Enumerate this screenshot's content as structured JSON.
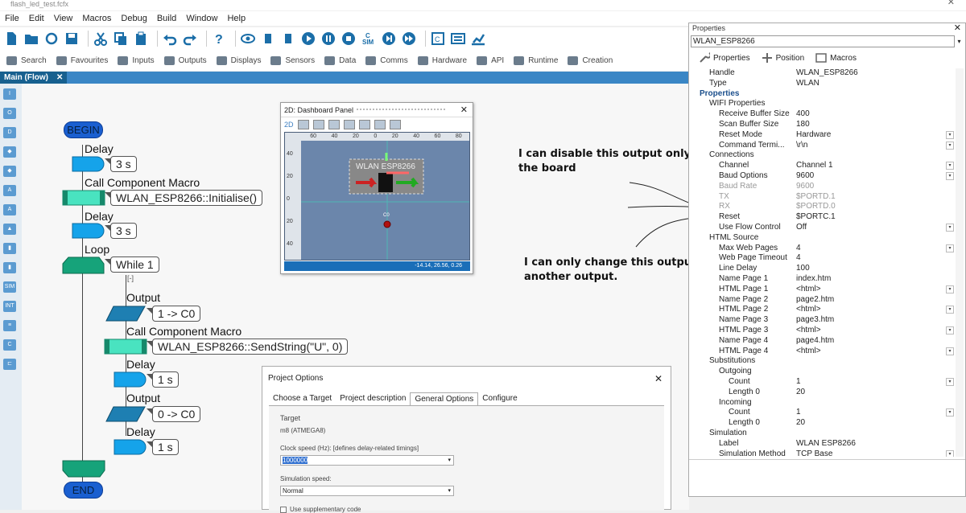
{
  "window": {
    "title": "flash_led_test.fcfx",
    "close": "✕"
  },
  "menu": [
    "File",
    "Edit",
    "View",
    "Macros",
    "Debug",
    "Build",
    "Window",
    "Help"
  ],
  "toolbar2": [
    "Search",
    "Favourites",
    "Inputs",
    "Outputs",
    "Displays",
    "Sensors",
    "Data",
    "Comms",
    "Hardware",
    "API",
    "Runtime",
    "Creation"
  ],
  "tab": {
    "label": "Main (Flow)",
    "close": "✕"
  },
  "leftbar": [
    "I",
    "O",
    "D",
    "◆",
    "◆",
    "A",
    "A",
    "▲",
    "▮",
    "▮",
    "SIM",
    "INT",
    "≡",
    "C",
    "⊏"
  ],
  "flow": {
    "begin": "BEGIN",
    "end": "END",
    "delay_label": "Delay",
    "delay1": "3 s",
    "macro_label": "Call Component Macro",
    "macro1": "WLAN_ESP8266::Initialise()",
    "delay2": "3 s",
    "loop_label": "Loop",
    "loop_cond": "While 1",
    "loop_marker": "[-]",
    "output_label": "Output",
    "out1": "1 -> C0",
    "macro2": "WLAN_ESP8266::SendString(\"U\", 0)",
    "delay3": "1 s",
    "out2": "0 -> C0",
    "delay4": "1 s"
  },
  "dashboard": {
    "title": "2D: Dashboard Panel",
    "close": "✕",
    "tool_label": "2D",
    "component_label": "WLAN ESP8266",
    "status": "-14.14, 26.56, 0.26",
    "ruler_top": [
      "60",
      "40",
      "20",
      "0",
      "20",
      "40",
      "60",
      "80"
    ],
    "ruler_left": [
      "40",
      "20",
      "0",
      "20",
      "40"
    ],
    "point_label": "C0"
  },
  "annotations": {
    "a1_line1": "I can disable this output only on",
    "a1_line2": "the board",
    "a2_line1": "I can only change this output to",
    "a2_line2": "another output."
  },
  "properties": {
    "title": "Properties",
    "close": "✕",
    "selected": "WLAN_ESP8266",
    "tabs": [
      "Properties",
      "Position",
      "Macros"
    ],
    "rows": [
      {
        "name": "Handle",
        "value": "WLAN_ESP8266",
        "indent": 1
      },
      {
        "name": "Type",
        "value": "WLAN",
        "indent": 1
      },
      {
        "name": "Properties",
        "value": "",
        "indent": 0,
        "head": true
      },
      {
        "name": "WIFI Properties",
        "value": "",
        "indent": 1
      },
      {
        "name": "Receive Buffer Size",
        "value": "400",
        "indent": 2
      },
      {
        "name": "Scan Buffer Size",
        "value": "180",
        "indent": 2
      },
      {
        "name": "Reset Mode",
        "value": "Hardware",
        "indent": 2,
        "dd": true
      },
      {
        "name": "Command Termi...",
        "value": "\\r\\n",
        "indent": 2,
        "dd": true
      },
      {
        "name": "Connections",
        "value": "",
        "indent": 1
      },
      {
        "name": "Channel",
        "value": "Channel 1",
        "indent": 2,
        "dd": true
      },
      {
        "name": "Baud Options",
        "value": "9600",
        "indent": 2,
        "dd": true
      },
      {
        "name": "Baud Rate",
        "value": "9600",
        "indent": 2,
        "grey": true
      },
      {
        "name": "TX",
        "value": "$PORTD.1",
        "indent": 2,
        "grey": true
      },
      {
        "name": "RX",
        "value": "$PORTD.0",
        "indent": 2,
        "grey": true
      },
      {
        "name": "Reset",
        "value": "$PORTC.1",
        "indent": 2
      },
      {
        "name": "Use Flow Control",
        "value": "Off",
        "indent": 2,
        "dd": true
      },
      {
        "name": "HTML Source",
        "value": "",
        "indent": 1
      },
      {
        "name": "Max Web Pages",
        "value": "4",
        "indent": 2,
        "dd": true
      },
      {
        "name": "Web Page Timeout",
        "value": "4",
        "indent": 2
      },
      {
        "name": "Line Delay",
        "value": "100",
        "indent": 2
      },
      {
        "name": "Name Page 1",
        "value": "index.htm",
        "indent": 2
      },
      {
        "name": "HTML Page 1",
        "value": "<html>",
        "indent": 2,
        "dd": true
      },
      {
        "name": "Name Page 2",
        "value": "page2.htm",
        "indent": 2
      },
      {
        "name": "HTML Page 2",
        "value": "<html>",
        "indent": 2,
        "dd": true
      },
      {
        "name": "Name Page 3",
        "value": "page3.htm",
        "indent": 2
      },
      {
        "name": "HTML Page 3",
        "value": "<html>",
        "indent": 2,
        "dd": true
      },
      {
        "name": "Name Page 4",
        "value": "page4.htm",
        "indent": 2
      },
      {
        "name": "HTML Page 4",
        "value": "<html>",
        "indent": 2,
        "dd": true
      },
      {
        "name": "Substitutions",
        "value": "",
        "indent": 1
      },
      {
        "name": "Outgoing",
        "value": "",
        "indent": 2
      },
      {
        "name": "Count",
        "value": "1",
        "indent": 3,
        "dd": true
      },
      {
        "name": "Length 0",
        "value": "20",
        "indent": 3
      },
      {
        "name": "Incoming",
        "value": "",
        "indent": 2
      },
      {
        "name": "Count",
        "value": "1",
        "indent": 3,
        "dd": true
      },
      {
        "name": "Length 0",
        "value": "20",
        "indent": 3
      },
      {
        "name": "Simulation",
        "value": "",
        "indent": 1
      },
      {
        "name": "Label",
        "value": "WLAN ESP8266",
        "indent": 2
      },
      {
        "name": "Simulation Method",
        "value": "TCP Base",
        "indent": 2,
        "dd": true
      }
    ]
  },
  "project_options": {
    "title": "Project Options",
    "close": "✕",
    "tabs": [
      "Choose a Target",
      "Project description",
      "General Options",
      "Configure"
    ],
    "active_tab": "General Options",
    "target_label": "Target",
    "target_value": "m8 (ATMEGA8)",
    "clock_label": "Clock speed (Hz): [defines delay-related timings]",
    "clock_value": "1000000",
    "sim_label": "Simulation speed:",
    "sim_value": "Normal",
    "supp_label": "Use supplementary code"
  },
  "colors": {
    "accent": "#3a86c5",
    "tab_active": "#17608f",
    "flow_block": "#15a3ea",
    "macro_block": "#49e3c0",
    "loop_block": "#16a37a",
    "term": "#1a5fd0"
  }
}
